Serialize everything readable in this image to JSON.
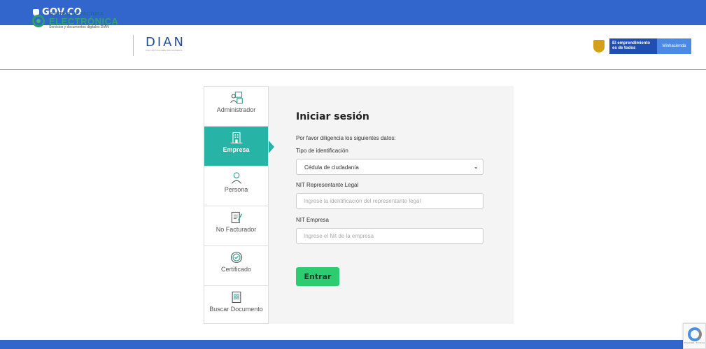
{
  "topbar": {
    "brand": "GOV.CO"
  },
  "header": {
    "sfe_line1": "SISTEMA DE FACTURA",
    "sfe_line2": "ELECTRÓNICA",
    "sfe_line3": "Servicios y documentos digitales DIAN",
    "dian": "DIAN",
    "dian_tag": "POR UNA COLOMBIA MÁS HONESTA",
    "min_blue": "El emprendimiento es de todos",
    "min_light": "Minhacienda"
  },
  "sidebar": {
    "items": [
      {
        "label": "Administrador",
        "icon": "admin-icon"
      },
      {
        "label": "Empresa",
        "icon": "building-icon"
      },
      {
        "label": "Persona",
        "icon": "person-icon"
      },
      {
        "label": "No Facturador",
        "icon": "document-edit-icon"
      },
      {
        "label": "Certificado",
        "icon": "certificate-icon"
      },
      {
        "label": "Buscar Documento",
        "icon": "search-document-icon"
      }
    ],
    "active": "Empresa"
  },
  "form": {
    "title": "Iniciar sesión",
    "intro": "Por favor diligencia los siguientes datos:",
    "tipo_label": "Tipo de identificación",
    "tipo_value": "Cédula de ciudadanía",
    "nit_rl_label": "NIT Representante Legal",
    "nit_rl_placeholder": "Ingrese la identificación del representante legal",
    "nit_emp_label": "NIT Empresa",
    "nit_emp_placeholder": "Ingrese el Nit de la empresa",
    "submit": "Entrar"
  },
  "recaptcha": {
    "text": "Privacidad - Términos"
  },
  "colors": {
    "gov_blue": "#3366cc",
    "accent_teal": "#27b3a6",
    "submit_green": "#2ecc71"
  }
}
